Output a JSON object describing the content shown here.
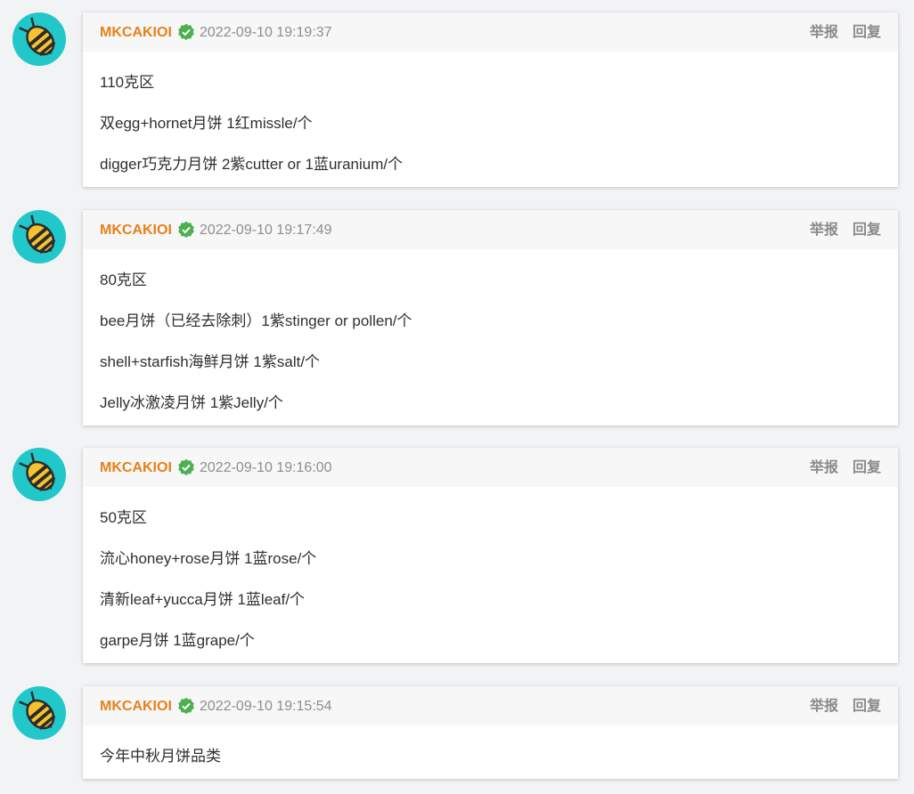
{
  "colors": {
    "username": "#e8811a",
    "verified": "#4caf50",
    "avatar_bg": "#22c7c9",
    "timestamp": "#8e8e8e"
  },
  "actions": {
    "report_label": "举报",
    "reply_label": "回复"
  },
  "comments": [
    {
      "username": "MKCAKIOI",
      "verified_icon": "verified-check-icon",
      "avatar_icon": "bee-avatar",
      "timestamp": "2022-09-10 19:19:37",
      "lines": [
        "110克区",
        "双egg+hornet月饼 1红missle/个",
        "digger巧克力月饼 2紫cutter or 1蓝uranium/个"
      ]
    },
    {
      "username": "MKCAKIOI",
      "verified_icon": "verified-check-icon",
      "avatar_icon": "bee-avatar",
      "timestamp": "2022-09-10 19:17:49",
      "lines": [
        "80克区",
        "bee月饼（已经去除刺）1紫stinger or pollen/个",
        "shell+starfish海鲜月饼 1紫salt/个",
        "Jelly冰激凌月饼 1紫Jelly/个"
      ]
    },
    {
      "username": "MKCAKIOI",
      "verified_icon": "verified-check-icon",
      "avatar_icon": "bee-avatar",
      "timestamp": "2022-09-10 19:16:00",
      "lines": [
        "50克区",
        "流心honey+rose月饼 1蓝rose/个",
        "清新leaf+yucca月饼 1蓝leaf/个",
        "garpe月饼 1蓝grape/个"
      ]
    },
    {
      "username": "MKCAKIOI",
      "verified_icon": "verified-check-icon",
      "avatar_icon": "bee-avatar",
      "timestamp": "2022-09-10 19:15:54",
      "lines": [
        "今年中秋月饼品类"
      ]
    }
  ]
}
